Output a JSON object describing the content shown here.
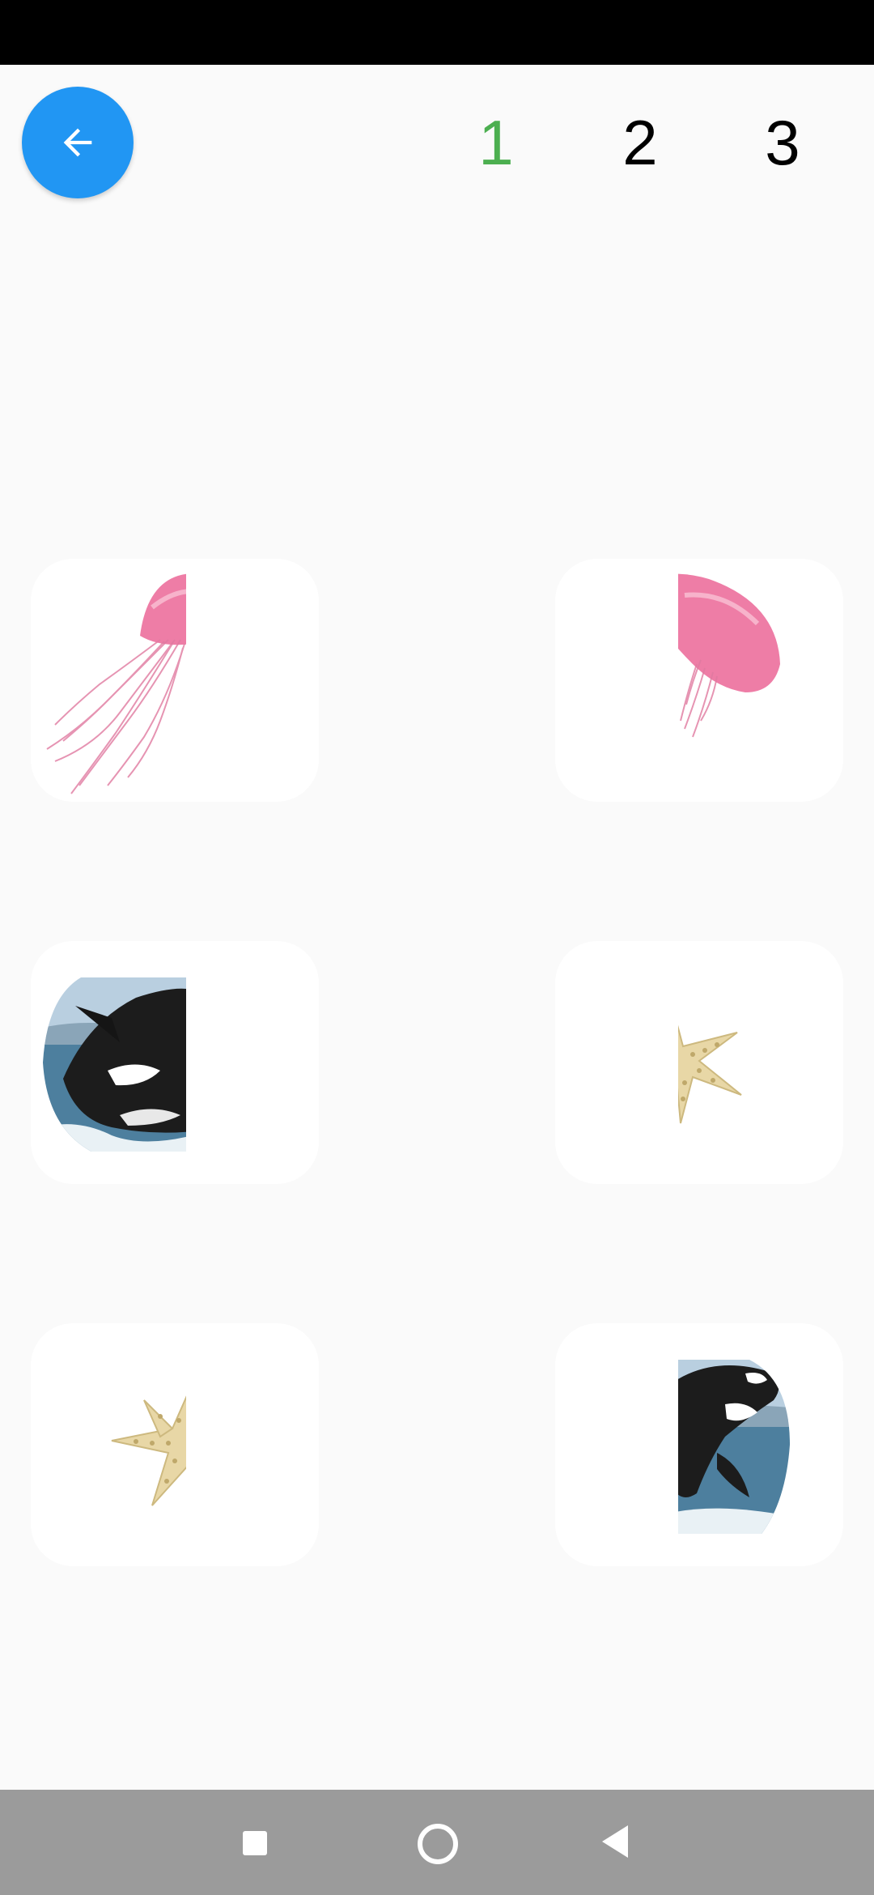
{
  "header": {
    "levels": [
      {
        "label": "1",
        "color": "#4caf50",
        "active": true
      },
      {
        "label": "2",
        "color": "#000000",
        "active": false
      },
      {
        "label": "3",
        "color": "#000000",
        "active": false
      }
    ]
  },
  "colors": {
    "accent": "#2196f3",
    "active_level": "#4caf50",
    "background": "#fafafa",
    "card": "#ffffff",
    "nav_bar": "#9b9b9b"
  },
  "cards": [
    {
      "name": "jellyfish-left-half-card",
      "icon": "jellyfish-left-half-image"
    },
    {
      "name": "jellyfish-right-half-card",
      "icon": "jellyfish-right-half-image"
    },
    {
      "name": "orca-left-half-card",
      "icon": "orca-left-half-image"
    },
    {
      "name": "starfish-right-half-card",
      "icon": "starfish-right-half-image"
    },
    {
      "name": "starfish-left-half-card",
      "icon": "starfish-left-half-image"
    },
    {
      "name": "orca-right-half-card",
      "icon": "orca-right-half-image"
    }
  ],
  "nav": {
    "icons": [
      "recent-apps-icon",
      "home-icon",
      "back-nav-icon"
    ]
  }
}
